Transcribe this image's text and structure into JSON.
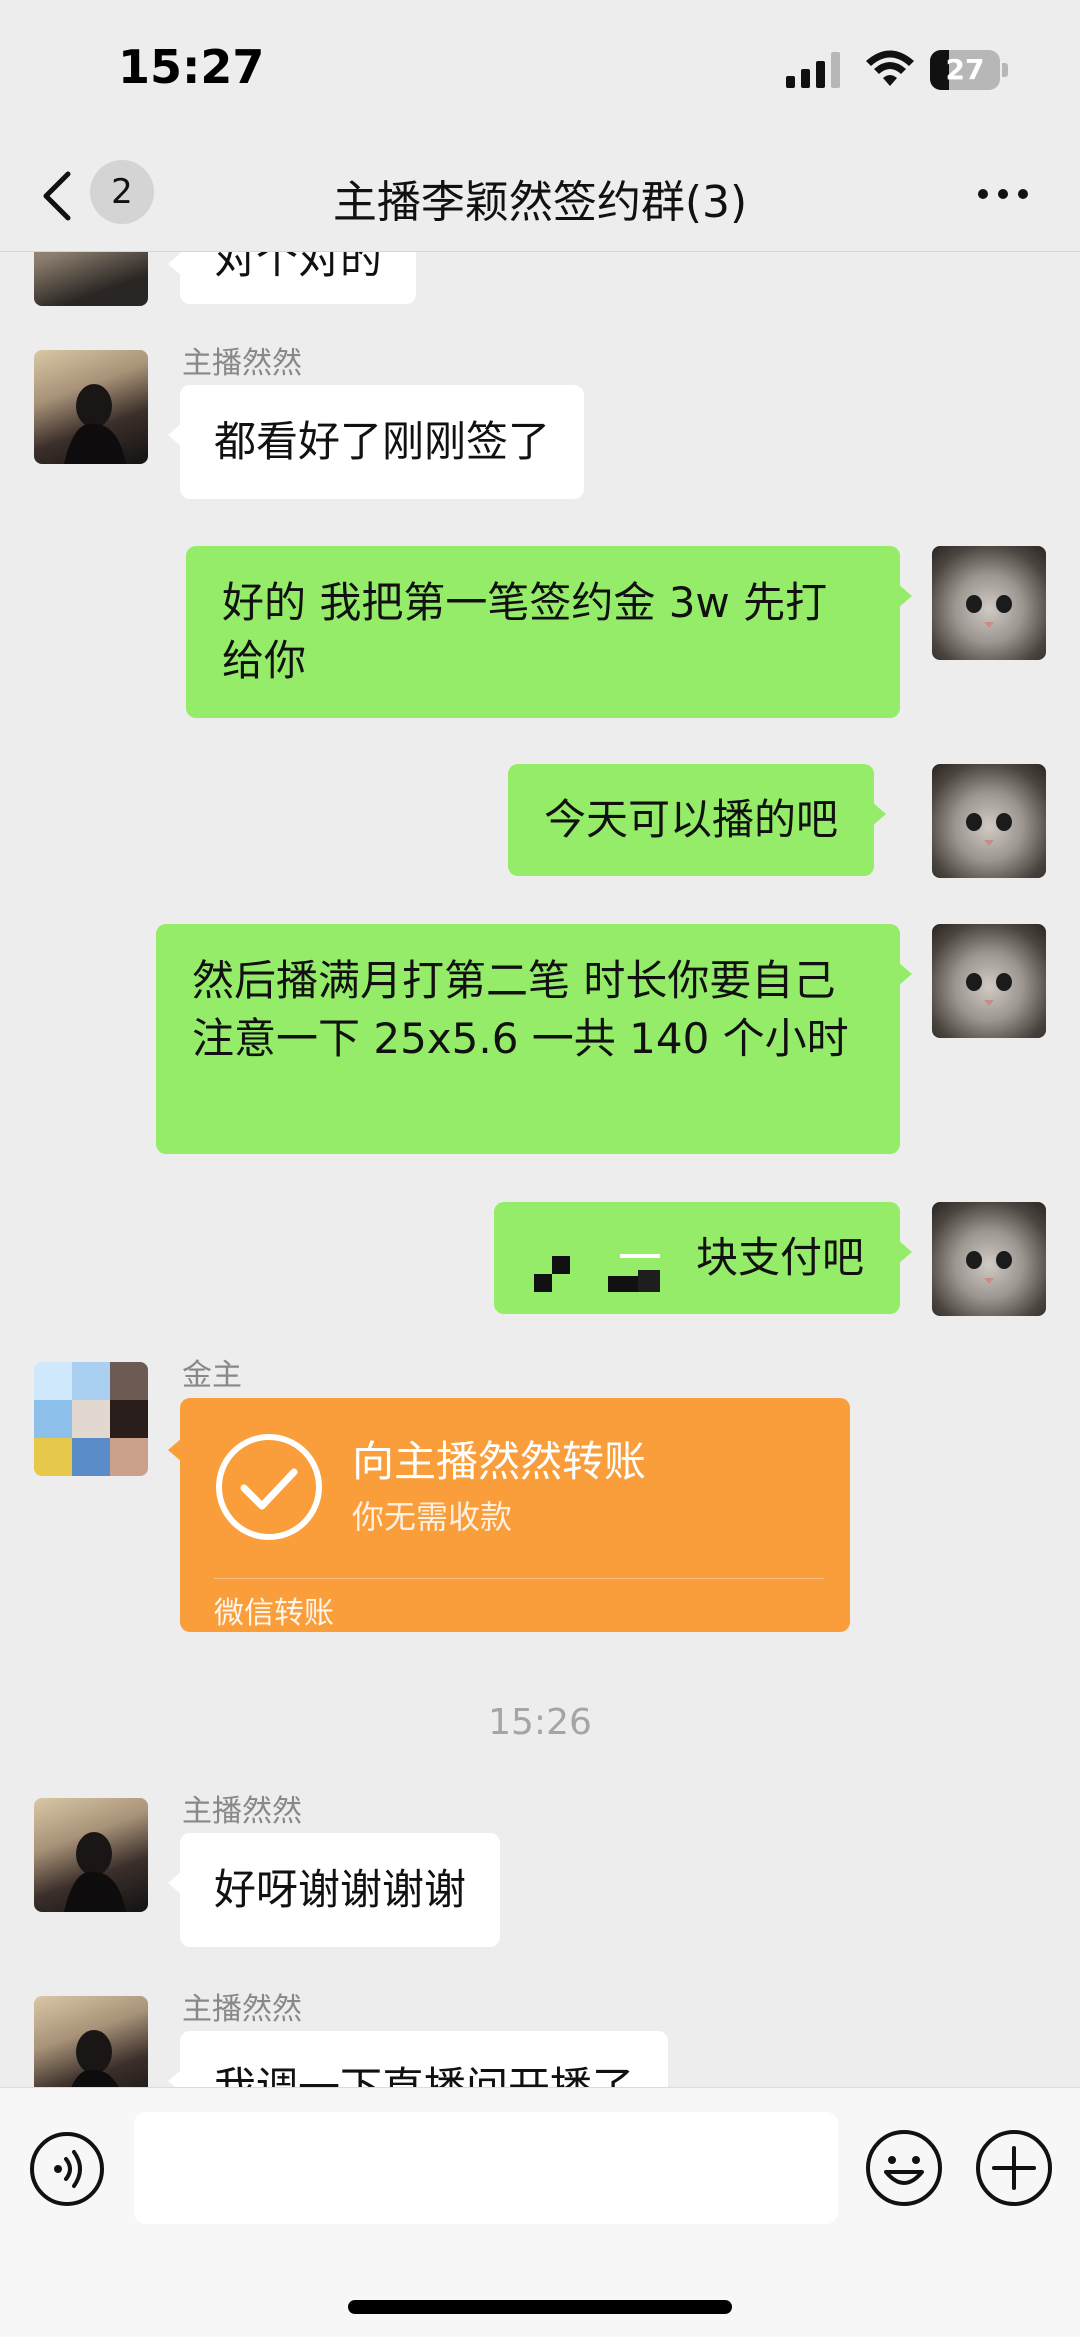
{
  "status_bar": {
    "time": "15:27",
    "battery": "27",
    "battery_level": 0.27
  },
  "header": {
    "unread_count": "2",
    "title": "主播李颖然签约群(3)"
  },
  "messages": [
    {
      "type": "text",
      "direction": "in",
      "text": "对个对的"
    },
    {
      "type": "text",
      "direction": "in",
      "sender": "主播然然",
      "text": "都看好了刚刚签了"
    },
    {
      "type": "text",
      "direction": "out",
      "text": "好的 我把第一笔签约金 3w 先打给你"
    },
    {
      "type": "text",
      "direction": "out",
      "text": "今天可以播的吧"
    },
    {
      "type": "text",
      "direction": "out",
      "text": "然后播满月打第二笔  时长你要自己注意一下 25x5.6 一共 140 个小时"
    },
    {
      "type": "text",
      "direction": "out",
      "text": "块支付吧"
    },
    {
      "type": "transfer",
      "direction": "in",
      "sender": "金主",
      "title": "向主播然然转账",
      "subtitle": "你无需收款",
      "footer": "微信转账"
    },
    {
      "type": "time",
      "text": "15:26"
    },
    {
      "type": "text",
      "direction": "in",
      "sender": "主播然然",
      "text": "好呀谢谢谢谢"
    },
    {
      "type": "text",
      "direction": "in",
      "sender": "主播然然",
      "text": "我调一下直播间开播了"
    }
  ],
  "colors": {
    "outgoing_bubble": "#95ec69",
    "incoming_bubble": "#ffffff",
    "transfer_card": "#fa9d3b",
    "background": "#ededed"
  },
  "icons": [
    "back-icon",
    "more-icon",
    "voice-icon",
    "emoji-icon",
    "plus-icon",
    "checkmark-icon",
    "signal-icon",
    "wifi-icon",
    "battery-icon"
  ]
}
